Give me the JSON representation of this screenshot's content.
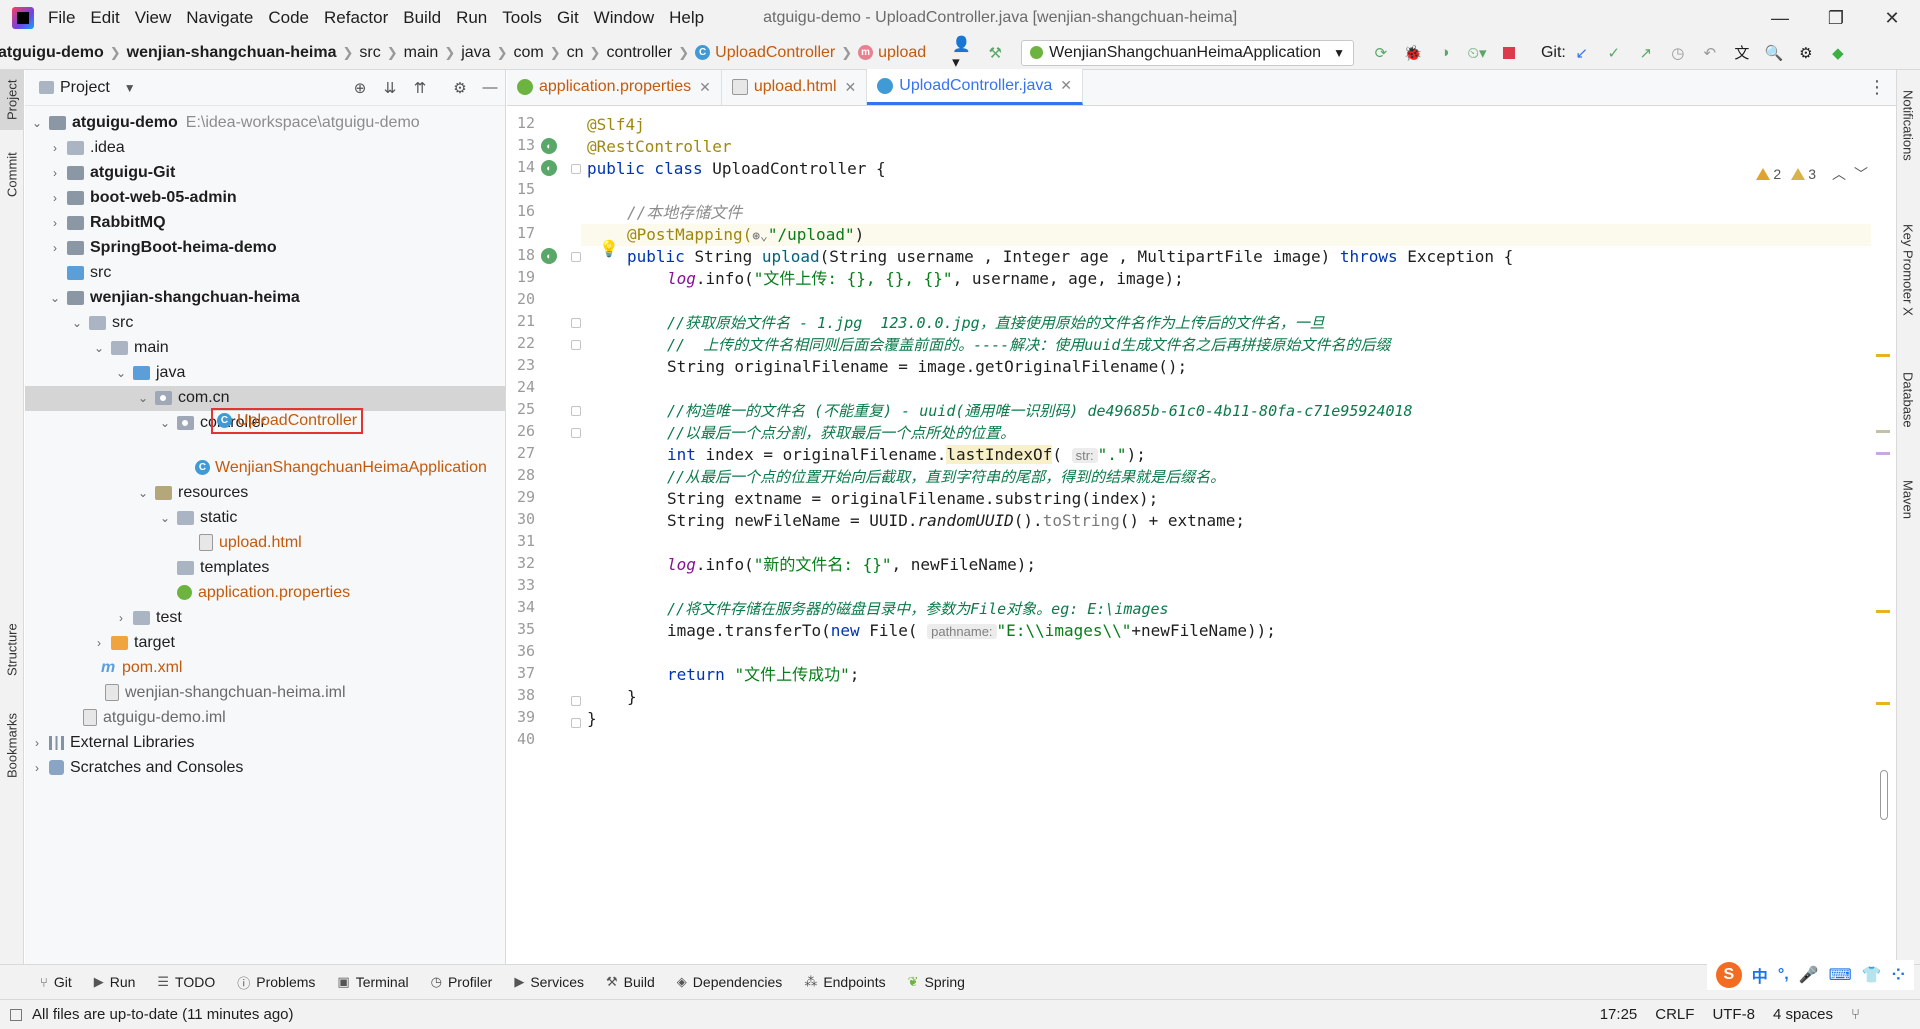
{
  "menubar": {
    "items": [
      "File",
      "Edit",
      "View",
      "Navigate",
      "Code",
      "Refactor",
      "Build",
      "Run",
      "Tools",
      "Git",
      "Window",
      "Help"
    ],
    "window_title": "atguigu-demo - UploadController.java [wenjian-shangchuan-heima]"
  },
  "navbar": {
    "crumbs": [
      "atguigu-demo",
      "wenjian-shangchuan-heima",
      "src",
      "main",
      "java",
      "com",
      "cn",
      "controller",
      "UploadController",
      "upload"
    ],
    "run_config": "WenjianShangchuanHeimaApplication",
    "git_label": "Git:"
  },
  "left_strip": [
    "Project",
    "Commit",
    "Structure",
    "Bookmarks"
  ],
  "right_strip": [
    "Notifications",
    "Key Promoter X",
    "Database",
    "Maven"
  ],
  "project": {
    "title": "Project",
    "root_name": "atguigu-demo",
    "root_path": "E:\\idea-workspace\\atguigu-demo",
    "nodes": {
      "idea": ".idea",
      "git": "atguigu-Git",
      "boot": "boot-web-05-admin",
      "rabbit": "RabbitMQ",
      "springboot": "SpringBoot-heima-demo",
      "src_root": "src",
      "module": "wenjian-shangchuan-heima",
      "src": "src",
      "main": "main",
      "java": "java",
      "comcn": "com.cn",
      "controller": "controller",
      "upload_controller": "UploadController",
      "application": "WenjianShangchuanHeimaApplication",
      "resources": "resources",
      "static": "static",
      "upload_html": "upload.html",
      "templates": "templates",
      "app_props": "application.properties",
      "test": "test",
      "target": "target",
      "pom": "pom.xml",
      "iml_module": "wenjian-shangchuan-heima.iml",
      "iml_root": "atguigu-demo.iml",
      "ext_libs": "External Libraries",
      "scratches": "Scratches and Consoles"
    }
  },
  "editor": {
    "tabs": [
      {
        "label": "application.properties",
        "active": false
      },
      {
        "label": "upload.html",
        "active": false
      },
      {
        "label": "UploadController.java",
        "active": true
      }
    ],
    "inspections": {
      "warnings": "2",
      "weak_warnings": "3"
    },
    "line_numbers": [
      "12",
      "13",
      "14",
      "15",
      "16",
      "17",
      "18",
      "19",
      "20",
      "21",
      "22",
      "23",
      "24",
      "25",
      "26",
      "27",
      "28",
      "29",
      "30",
      "31",
      "32",
      "33",
      "34",
      "35",
      "36",
      "37",
      "38",
      "39",
      "40"
    ],
    "code": {
      "l12": "@Slf4j",
      "l13": "@RestController",
      "l14_kw": "public class ",
      "l14_name": "UploadController {",
      "l16": "//本地存储文件",
      "l17_an": "@PostMapping(",
      "l17_str": "\"/upload\"",
      "l17_end": ")",
      "l18_a": "public ",
      "l18_b": "String ",
      "l18_fn": "upload",
      "l18_c": "(String username , Integer age , MultipartFile image) ",
      "l18_throws": "throws ",
      "l18_d": "Exception {",
      "l19_log": "log",
      "l19_a": ".info(",
      "l19_str": "\"文件上传: {}, {}, {}\"",
      "l19_b": ", username, age, image);",
      "l21": "//获取原始文件名 - 1.jpg  123.0.0.jpg，直接使用原始的文件名作为上传后的文件名，一旦",
      "l22": "//  上传的文件名相同则后面会覆盖前面的。----解决：使用uuid生成文件名之后再拼接原始文件名的后缀",
      "l23": "String originalFilename = image.getOriginalFilename();",
      "l25": "//构造唯一的文件名 (不能重复) - uuid(通用唯一识别码) de49685b-61c0-4b11-80fa-c71e95924018",
      "l26": "//以最后一个点分割，获取最后一个点所处的位置。",
      "l27_kw": "int ",
      "l27_a": "index = originalFilename.",
      "l27_fn": "lastIndexOf",
      "l27_hint": "str:",
      "l27_str": "\".\"",
      "l27_end": ");",
      "l28": "//从最后一个点的位置开始向后截取，直到字符串的尾部，得到的结果就是后缀名。",
      "l29": "String extname = originalFilename.substring(index);",
      "l30_a": "String newFileName = UUID.",
      "l30_it": "randomUUID",
      "l30_b": "().",
      "l30_gray": "toString",
      "l30_c": "() + extname;",
      "l32_log": "log",
      "l32_a": ".info(",
      "l32_str": "\"新的文件名: {}\"",
      "l32_b": ", newFileName);",
      "l34": "//将文件存储在服务器的磁盘目录中，参数为File对象。eg: E:\\images",
      "l35_a": "image.transferTo(",
      "l35_kw": "new ",
      "l35_b": "File(",
      "l35_hint": "pathname:",
      "l35_str": "\"E:\\\\images\\\\\"",
      "l35_c": "+newFileName));",
      "l37_kw": "return ",
      "l37_str": "\"文件上传成功\"",
      "l37_end": ";",
      "l38": "}",
      "l39": "}"
    }
  },
  "toolwindows": [
    "Git",
    "Run",
    "TODO",
    "Problems",
    "Terminal",
    "Profiler",
    "Services",
    "Build",
    "Dependencies",
    "Endpoints",
    "Spring"
  ],
  "status": {
    "message": "All files are up-to-date (11 minutes ago)",
    "position": "17:25",
    "line_sep": "CRLF",
    "encoding": "UTF-8",
    "indent": "4 spaces"
  },
  "ime": {
    "lang": "中"
  },
  "colors": {
    "accent": "#3574f0",
    "highlight_box": "#e3342f",
    "keyword": "#0033b3",
    "annotation": "#9e880d",
    "string": "#067d17"
  }
}
